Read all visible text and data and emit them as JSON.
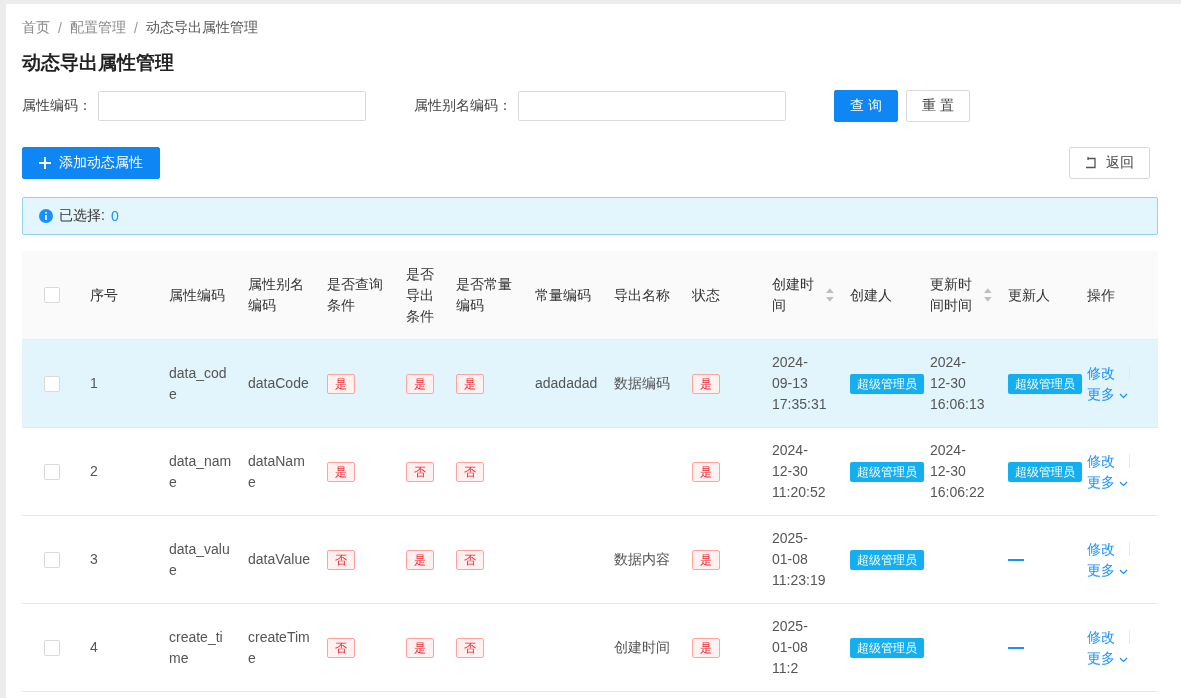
{
  "breadcrumb": [
    {
      "label": "首页"
    },
    {
      "separator": "/",
      "label": "配置管理"
    },
    {
      "separator": "/",
      "label": "动态导出属性管理"
    }
  ],
  "title": "动态导出属性管理",
  "filters": [
    {
      "label": "属性编码："
    },
    {
      "label": "属性别名编码："
    }
  ],
  "filter_buttons": [
    {
      "label": "查 询",
      "kind": "primary"
    },
    {
      "label": "重 置",
      "kind": "default"
    }
  ],
  "add_button": {
    "label": "添加动态属性"
  },
  "back_button": {
    "label": "返回"
  },
  "selection_alert": {
    "label": "已选择:",
    "count": "0"
  },
  "table": {
    "header_checkbox": {
      "checked": false
    },
    "columns": [
      {
        "label": "序号",
        "sortable": false
      },
      {
        "label": "属性编码",
        "sortable": false
      },
      {
        "label": "属性别名编码",
        "sortable": false
      },
      {
        "label": "是否查询条件",
        "sortable": false
      },
      {
        "label": "是否导出条件",
        "sortable": false
      },
      {
        "label": "是否常量编码",
        "sortable": false
      },
      {
        "label": "常量编码",
        "sortable": false
      },
      {
        "label": "导出名称",
        "sortable": false
      },
      {
        "label": "状态",
        "sortable": false
      },
      {
        "label": "创建时间",
        "sortable": true
      },
      {
        "label": "创建人",
        "sortable": false
      },
      {
        "label": "更新时间时间",
        "sortable": true
      },
      {
        "label": "更新人",
        "sortable": false
      },
      {
        "label": "操作",
        "sortable": false
      }
    ],
    "rows": [
      {
        "checked": false,
        "highlighted": true,
        "index": "1",
        "attr_code": "data_code",
        "alias_code": "dataCode",
        "is_query": "是",
        "is_export": "是",
        "is_constant": "是",
        "constant_code": "adadadad",
        "export_name": "数据编码",
        "status": "是",
        "created_at": "2024-09-13 17:35:31",
        "creator": "超级管理员",
        "updated_at": "2024-12-30 16:06:13",
        "updater": {
          "kind": "tag",
          "text": "超级管理员"
        },
        "actions": {
          "edit": "修改",
          "more": "更多"
        }
      },
      {
        "checked": false,
        "highlighted": false,
        "index": "2",
        "attr_code": "data_name",
        "alias_code": "dataName",
        "is_query": "是",
        "is_export": "否",
        "is_constant": "否",
        "status": "是",
        "created_at": "2024-12-30 11:20:52",
        "creator": "超级管理员",
        "updated_at": "2024-12-30 16:06:22",
        "updater": {
          "kind": "tag",
          "text": "超级管理员"
        },
        "actions": {
          "edit": "修改",
          "more": "更多"
        }
      },
      {
        "checked": false,
        "highlighted": false,
        "index": "3",
        "attr_code": "data_value",
        "alias_code": "dataValue",
        "is_query": "否",
        "is_export": "是",
        "is_constant": "否",
        "export_name": "数据内容",
        "status": "是",
        "created_at": "2025-01-08 11:23:19",
        "creator": "超级管理员",
        "updater": {
          "kind": "dash"
        },
        "actions": {
          "edit": "修改",
          "more": "更多"
        }
      },
      {
        "checked": false,
        "highlighted": false,
        "index": "4",
        "attr_code": "create_time",
        "alias_code": "createTime",
        "is_query": "否",
        "is_export": "是",
        "is_constant": "否",
        "export_name": "创建时间",
        "status": "是",
        "created_at": "2025-01-08 11:2",
        "creator": "超级管理员",
        "updater": {
          "kind": "dash"
        },
        "actions": {
          "edit": "修改",
          "more": "更多"
        }
      }
    ]
  }
}
